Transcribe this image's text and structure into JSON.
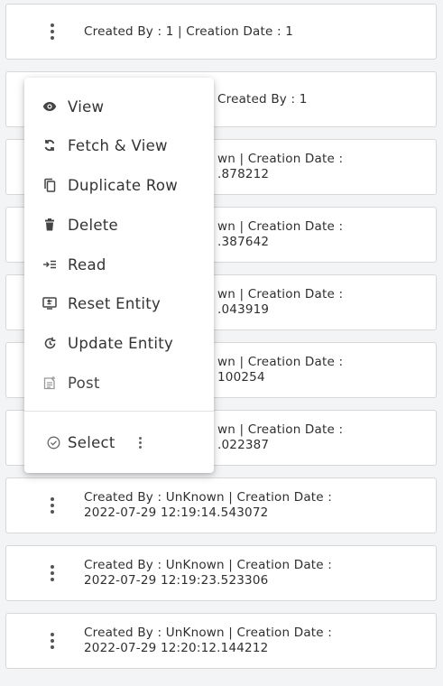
{
  "rows": [
    {
      "line1": "Created By : 1 | Creation Date : 1",
      "line2": ""
    },
    {
      "line1": "Created By : 1",
      "line2": ""
    },
    {
      "line1": "wn | Creation Date :",
      "line2": ".878212"
    },
    {
      "line1": "wn | Creation Date :",
      "line2": ".387642"
    },
    {
      "line1": "wn | Creation Date :",
      "line2": ".043919"
    },
    {
      "line1": "wn | Creation Date :",
      "line2": "100254"
    },
    {
      "line1": "wn | Creation Date :",
      "line2": ".022387"
    },
    {
      "line1": "Created By : UnKnown | Creation Date :",
      "line2": "2022-07-29 12:19:14.543072"
    },
    {
      "line1": "Created By : UnKnown | Creation Date :",
      "line2": "2022-07-29 12:19:23.523306"
    },
    {
      "line1": "Created By : UnKnown | Creation Date :",
      "line2": "2022-07-29 12:20:12.144212"
    }
  ],
  "menu": {
    "items": [
      {
        "label": "View",
        "icon": "eye-icon"
      },
      {
        "label": "Fetch & View",
        "icon": "refresh-icon"
      },
      {
        "label": "Duplicate Row",
        "icon": "copy-icon"
      },
      {
        "label": "Delete",
        "icon": "trash-icon"
      },
      {
        "label": "Read",
        "icon": "read-icon"
      },
      {
        "label": "Reset Entity",
        "icon": "reset-icon"
      },
      {
        "label": "Update Entity",
        "icon": "update-icon"
      },
      {
        "label": "Post",
        "icon": "post-icon"
      }
    ],
    "select_label": "Select",
    "select_icon": "check-circle-icon"
  },
  "colors": {
    "background": "#f3f4f6",
    "card": "#ffffff",
    "text": "#2f2f2f"
  }
}
